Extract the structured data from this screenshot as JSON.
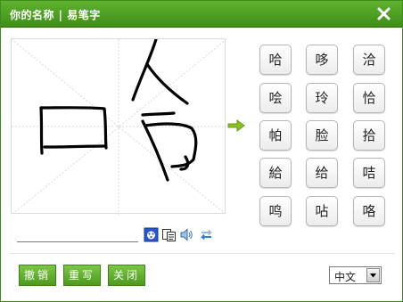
{
  "window": {
    "title": "你的名称 | 易笔字",
    "close_icon": "close-x-icon"
  },
  "handwriting": {
    "strokes_description_icon": "handwriting-canvas",
    "arrow_icon": "green-right-arrow-icon"
  },
  "candidates": [
    "哈",
    "哆",
    "洽",
    "哙",
    "玲",
    "恰",
    "帕",
    "脸",
    "拾",
    "給",
    "给",
    "咭",
    "鸣",
    "呫",
    "咯"
  ],
  "input": {
    "value": "",
    "placeholder": ""
  },
  "tools": {
    "paint_icon": "paint-palette-icon",
    "copy_icon": "copy-icon",
    "speaker_icon": "speaker-icon",
    "swap_icon": "swap-arrows-icon"
  },
  "buttons": {
    "undo": "撤销",
    "rewrite": "重写",
    "close": "关闭"
  },
  "language": {
    "selected": "中文",
    "arrow_icon": "dropdown-arrow-icon"
  },
  "colors": {
    "title_green": "#4c9a1e",
    "button_green": "#5fb12f",
    "ink": "#000000"
  }
}
